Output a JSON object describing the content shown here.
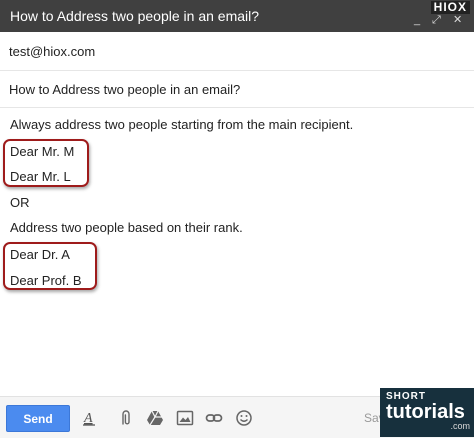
{
  "window": {
    "title": "How to Address two people in an email?",
    "logo_text": "HIOX",
    "minimize_glyph": "_",
    "popout_glyph": "⤢",
    "close_glyph": "✕"
  },
  "compose": {
    "to": "test@hiox.com",
    "subject": "How to Address two people in an email?"
  },
  "body": {
    "line1": "Always address two people starting from the main recipient.",
    "greeting1": "Dear Mr. M",
    "greeting2": "Dear Mr. L",
    "or": "OR",
    "line2": "Address two people based on their rank.",
    "greeting3": "Dear Dr. A",
    "greeting4": "Dear Prof. B"
  },
  "toolbar": {
    "send_label": "Send",
    "saved_label": "Sav",
    "icons": [
      "format-text-icon",
      "attach-icon",
      "drive-icon",
      "photo-icon",
      "link-icon",
      "emoji-icon"
    ]
  },
  "watermark": {
    "short": "SHORT",
    "tutorials": "tutorials",
    "com": ".com"
  },
  "colors": {
    "titlebar": "#404040",
    "send_button": "#4b8bef",
    "highlight_border": "#9e1b1b",
    "brand_bg": "#17303d"
  }
}
